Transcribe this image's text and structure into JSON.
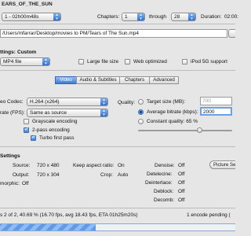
{
  "title_strip": "EARS_OF_THE_SUN",
  "source_row": {
    "title_value": "1 - 02h00m48s",
    "chapters_label": "Chapters:",
    "chapter_start": "1",
    "through_label": "through",
    "chapter_end": "28",
    "duration_label": "Duration:",
    "duration_value": "02:00:"
  },
  "destination": {
    "file_value": "/Users/mfarrar/Desktop/movies to PM/Tears of The Sun.mp4"
  },
  "output_settings": {
    "label": "ttings:",
    "preset": "Custom",
    "container_value": "MP4 file",
    "large_file": {
      "label": "Large file size",
      "checked": false
    },
    "web_optimized": {
      "label": "Web optimized",
      "checked": false
    },
    "ipod_5g": {
      "label": "iPod 5G support",
      "checked": false
    }
  },
  "tabs": [
    {
      "label": "Video",
      "active": true
    },
    {
      "label": "Audio & Subtitles",
      "active": false
    },
    {
      "label": "Chapters",
      "active": false
    },
    {
      "label": "Advanced",
      "active": false
    }
  ],
  "video": {
    "codec_label": "eo Codec:",
    "codec_value": "H.264 (x264)",
    "fps_label": "rate (FPS):",
    "fps_value": "Same as source",
    "grayscale": {
      "label": "Grayscale encoding",
      "checked": false
    },
    "two_pass": {
      "label": "2-pass encoding",
      "checked": true
    },
    "turbo": {
      "label": "Turbo first pass",
      "checked": true
    }
  },
  "quality": {
    "label": "Quality:",
    "target_size": {
      "label": "Target size (MB):",
      "value": "700",
      "selected": false
    },
    "avg_bitrate": {
      "label": "Average bitrate (kbps):",
      "value": "2000",
      "selected": true
    },
    "constant_quality": {
      "label": "Constant quality: 65 %",
      "selected": false,
      "level": 0.65
    }
  },
  "picture": {
    "header": "Settings",
    "source_label": "Source:",
    "source_value": "720 x 480",
    "output_label": "Output:",
    "output_value": "720 x 304",
    "anamorphic_label": "morphic:",
    "anamorphic_value": "Off",
    "keep_aspect_label": "Keep aspect ratio:",
    "keep_aspect_value": "On",
    "crop_label": "Crop:",
    "crop_value": "Auto",
    "denoise_label": "Denoise:",
    "denoise_value": "Off",
    "detelecine_label": "Detelecine:",
    "detelecine_value": "Off",
    "deinterlace_label": "Deinterlace:",
    "deinterlace_value": "Off",
    "deblock_label": "Deblock:",
    "deblock_value": "Off",
    "decomb_label": "Decomb:",
    "decomb_value": "Off",
    "picture_settings_button": "Picture Set"
  },
  "status": {
    "encode_text": "s 2 of 2, 40.69 % (16.70 fps, avg 18.43 fps, ETA 01h25m20s)",
    "pending_text": "1 encode pending (",
    "progress": 0.4069
  },
  "colors": {
    "accent": "#3b7ad6",
    "window_bg": "#e6e6e6"
  }
}
